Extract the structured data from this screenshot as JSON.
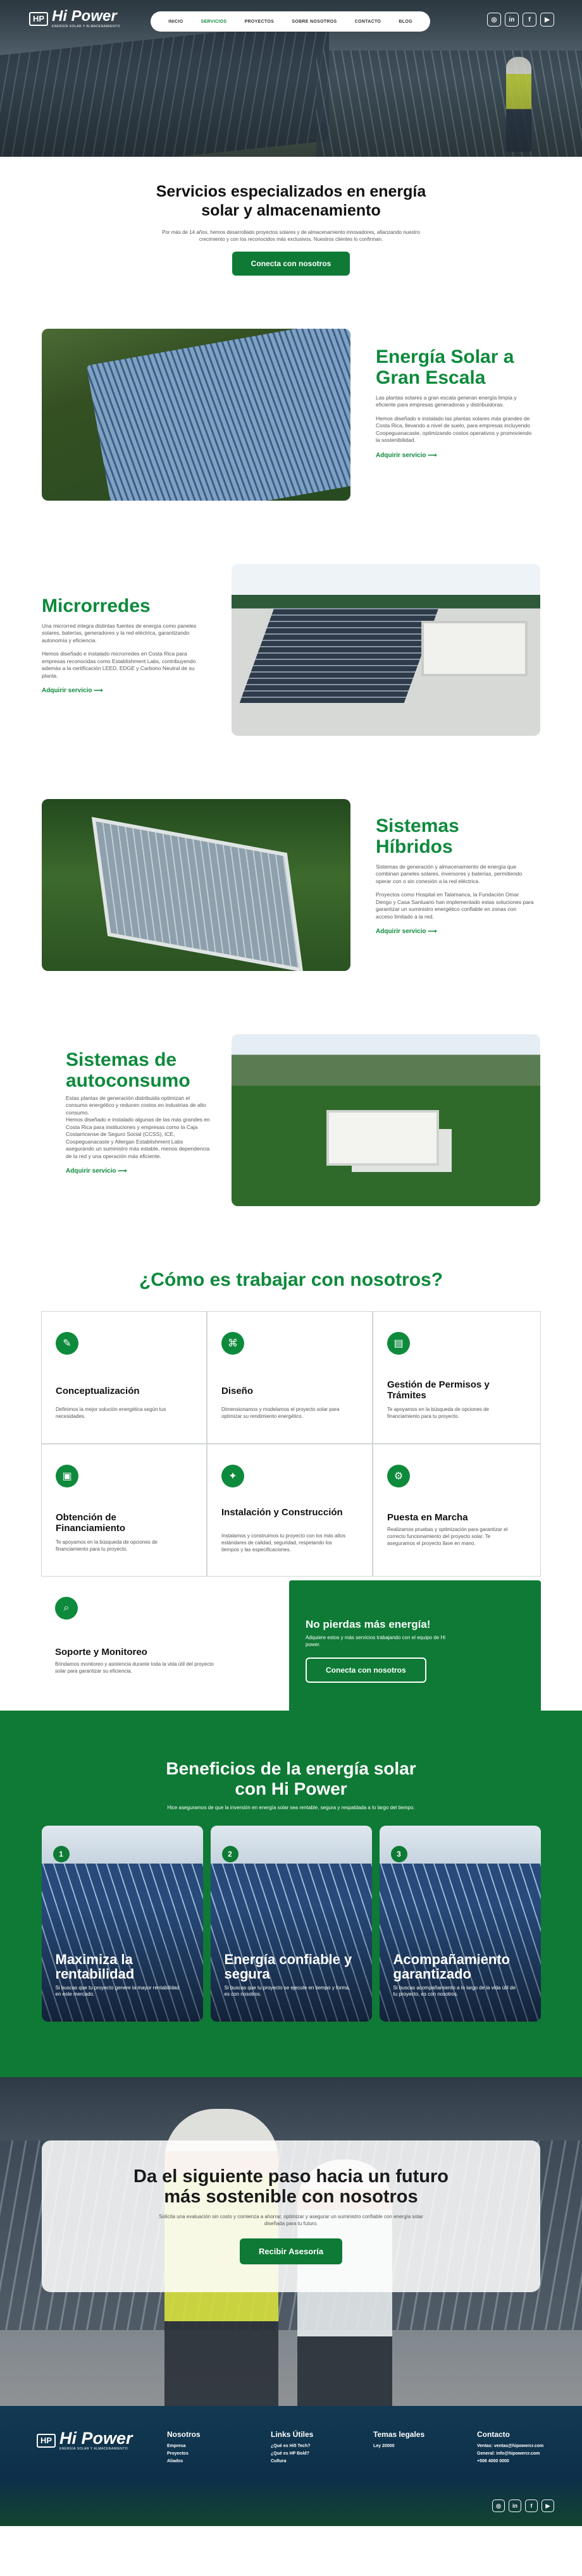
{
  "brand": {
    "name": "Hi Power",
    "mark": "HP",
    "tagline": "ENERGÍA SOLAR Y ALMACENAMIENTO"
  },
  "nav": [
    "INICIO",
    "SERVICIOS",
    "PROYECTOS",
    "SOBRE NOSOTROS",
    "CONTACTO",
    "BLOG"
  ],
  "social": [
    "◎",
    "in",
    "f",
    "▶"
  ],
  "intro": {
    "title": "Servicios especializados en energía solar y almacenamiento",
    "text": "Por más de 14 años, hemos desarrollado proyectos solares y de almacenamiento innovadores, afianzando nuestro crecimiento y con los reconocidos más exclusivos. Nuestros clientes lo confirman.",
    "button": "Conecta con nosotros"
  },
  "services": [
    {
      "title": "Energía Solar a Gran Escala",
      "p1": "Las plantas solares a gran escala generan energía limpia y eficiente para empresas generadoras y distribuidoras.",
      "p2": "Hemos diseñado e instalado las plantas solares más grandes de Costa Rica, llevando a nivel de suelo, para empresas incluyendo Coopeguanacaste, optimizando costos operativos y promoviendo la sostenibilidad.",
      "link": "Adquirir servicio ⟶"
    },
    {
      "title": "Microrredes",
      "p1": "Una microrred integra distintas fuentes de energía como paneles solares, baterías, generadores y la red eléctrica, garantizando autonomía y eficiencia.",
      "p2": "Hemos diseñado e instalado microrredes en Costa Rica para empresas reconocidas como Establishment Labs, contribuyendo además a la certificación LEED, EDGE y Carbono Neutral de su planta.",
      "link": "Adquirir servicio ⟶"
    },
    {
      "title": "Sistemas Híbridos",
      "p1": "Sistemas de generación y almacenamiento de energía que combinan paneles solares, inversores y baterías, permitiendo operar con o sin conexión a la red eléctrica.",
      "p2": "Proyectos como Hospital en Talamanca, la Fundación Omar Dengo y Casa Santuario han implementado estas soluciones para garantizar un suministro energético confiable en zonas con acceso limitado a la red.",
      "link": "Adquirir servicio ⟶"
    },
    {
      "title": "Sistemas de autoconsumo",
      "p1": "Estas plantas de generación distribuida optimizan el consumo energético y reducen costos en industrias de alto consumo.",
      "p2": "Hemos diseñado e instalado algunas de las más grandes en Costa Rica para instituciones y empresas como la Caja Costarricense de Seguro Social (CCSS), ICE, Coopeguanacaste y Allergan Establishment Labs asegurando un suministro más estable, menos dependencia de la red y una operación más eficiente.",
      "link": "Adquirir servicio ⟶"
    }
  ],
  "how": {
    "title": "¿Cómo es trabajar con nosotros?",
    "steps": [
      {
        "icon": "✎",
        "title": "Conceptualización",
        "text": "Definimos la mejor solución energética según tus necesidades."
      },
      {
        "icon": "⌘",
        "title": "Diseño",
        "text": "Dimensionamos y modelamos el proyecto solar para optimizar su rendimiento energético."
      },
      {
        "icon": "▤",
        "title": "Gestión de Permisos y Trámites",
        "text": "Te apoyamos en la búsqueda de opciones de financiamiento para tu proyecto."
      },
      {
        "icon": "▣",
        "title": "Obtención de Financiamiento",
        "text": "Te apoyamos en la búsqueda de opciones de financiamiento para tu proyecto."
      },
      {
        "icon": "✦",
        "title": "Instalación y Construcción",
        "text": "Instalamos y construimos tu proyecto con los más altos estándares de calidad, seguridad, respetando los tiempos y las especificaciones."
      },
      {
        "icon": "⚙",
        "title": "Puesta en Marcha",
        "text": "Realizamos pruebas y optimización para garantizar el correcto funcionamiento del proyecto solar. Te aseguramos el proyecto llave en mano."
      },
      {
        "icon": "⌕",
        "title": "Soporte y Monitoreo",
        "text": "Brindamos monitoreo y asistencia durante toda la vida útil del proyecto solar para garantizar su eficiencia."
      }
    ],
    "cta": {
      "title": "No pierdas más energía!",
      "text": "Adquiere estos y más servicios trabajando con el equipo de Hi power.",
      "button": "Conecta con nosotros"
    }
  },
  "benefits": {
    "title": "Beneficios de la energía solar con Hi Power",
    "sub": "Hice aseguramos de que la inversión en energía solar sea rentable, segura y respaldada a lo largo del tiempo.",
    "cards": [
      {
        "num": "1",
        "title": "Maximiza la rentabilidad",
        "text": "Si buscas que tu proyecto genere la mayor rentabilidad en este mercado."
      },
      {
        "num": "2",
        "title": "Energía confiable y segura",
        "text": "Si buscas que tu proyecto se ejecute en tiempo y forma, es con nosotros."
      },
      {
        "num": "3",
        "title": "Acompañamiento garantizado",
        "text": "Si buscas acompañamiento a lo largo de la vida útil de tu proyecto, es con nosotros."
      }
    ]
  },
  "next": {
    "title": "Da el siguiente paso hacia un futuro más sostenible con nosotros",
    "text": "Solicita una evaluación sin costo y comienza a ahorrar, optimizar y asegurar un suministro confiable con energía solar diseñada para tu futuro.",
    "button": "Recibir Asesoría"
  },
  "footer": {
    "cols": [
      {
        "title": "Nosotros",
        "items": [
          "Empresa",
          "Proyectos",
          "Aliados"
        ]
      },
      {
        "title": "Links Útiles",
        "items": [
          "¿Qué es Hi5 Tech?",
          "¿Qué es HP Bold?",
          "Cultura"
        ]
      },
      {
        "title": "Temas legales",
        "items": [
          "Ley 20000"
        ]
      },
      {
        "title": "Contacto",
        "items": [
          "Ventas: ventas@hipowercr.com",
          "General: info@hipowercr.com",
          "+506 4000 0000"
        ]
      }
    ]
  }
}
